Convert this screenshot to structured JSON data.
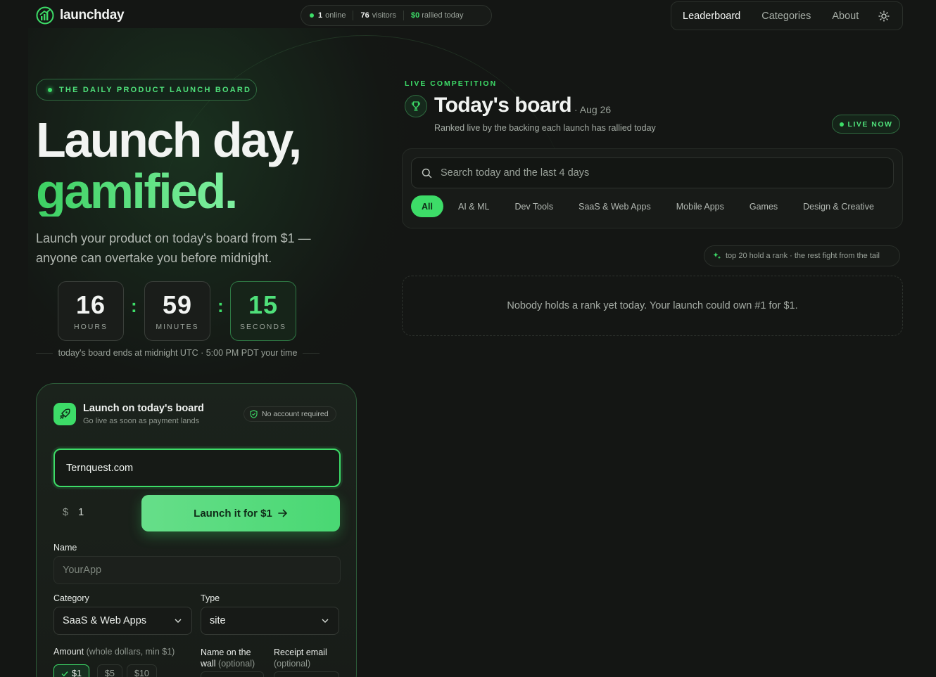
{
  "header": {
    "brand": "launchday",
    "stats": {
      "online_count": "1",
      "online_label": "online",
      "visitors_count": "76",
      "visitors_label": "visitors",
      "rallied_amount": "$0",
      "rallied_label": "rallied today"
    },
    "nav": [
      "Leaderboard",
      "Categories",
      "About"
    ]
  },
  "hero": {
    "pill": "THE DAILY PRODUCT LAUNCH BOARD",
    "headline_1": "Launch day,",
    "headline_2": "gamified.",
    "subtitle": "Launch your product on today's board from $1 — anyone can overtake you before midnight.",
    "countdown": {
      "hours": "16",
      "hours_label": "HOURS",
      "minutes": "59",
      "minutes_label": "MINUTES",
      "seconds": "15",
      "seconds_label": "SECONDS"
    },
    "ends_note": "today's board ends at midnight UTC · 5:00 PM PDT your time"
  },
  "launch_card": {
    "title": "Launch on today's board",
    "subtitle": "Go live as soon as payment lands",
    "no_account": "No account required",
    "url_value": "Ternquest.com",
    "currency": "$",
    "amount_value": "1",
    "launch_button": "Launch it for $1",
    "name_label": "Name",
    "name_placeholder": "YourApp",
    "category_label": "Category",
    "category_value": "SaaS & Web Apps",
    "type_label": "Type",
    "type_value": "site",
    "amount_label": "Amount",
    "amount_hint": "(whole dollars, min $1)",
    "wall_label": "Name on the wall",
    "wall_hint": "(optional)",
    "email_label": "Receipt email",
    "email_hint": "(optional)",
    "amount_options": [
      "$1",
      "$5",
      "$10"
    ]
  },
  "board": {
    "eyebrow": "LIVE COMPETITION",
    "title": "Today's board",
    "date": "· Aug 26",
    "subtitle": "Ranked live by the backing each launch has rallied today",
    "live_badge": "LIVE NOW",
    "search_placeholder": "Search today and the last 4 days",
    "tabs": [
      "All",
      "AI & ML",
      "Dev Tools",
      "SaaS & Web Apps",
      "Mobile Apps",
      "Games",
      "Design & Creative"
    ],
    "tail_note": "top 20 hold a rank · the rest fight from the tail",
    "empty_message": "Nobody holds a rank yet today. Your launch could own #1 for $1."
  },
  "colors": {
    "accent": "#3ddc68",
    "background": "#141614"
  }
}
